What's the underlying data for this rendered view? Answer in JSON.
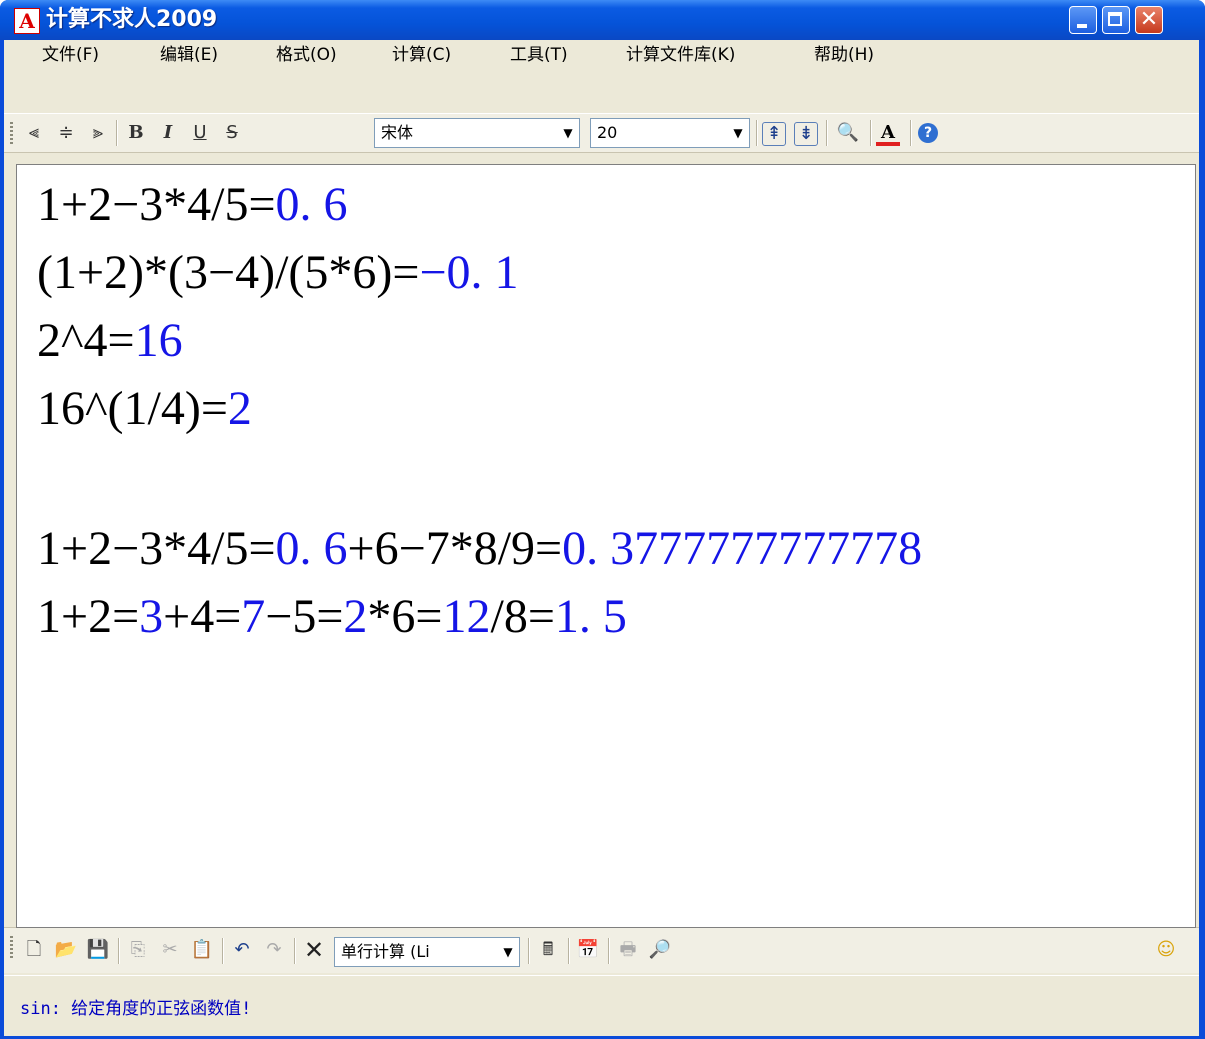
{
  "window": {
    "title": "计算不求人2009",
    "icon": "app-logo-icon"
  },
  "menu": {
    "file": "文件(F)",
    "edit": "编辑(E)",
    "format": "格式(O)",
    "compute": "计算(C)",
    "tools": "工具(T)",
    "library": "计算文件库(K)",
    "help": "帮助(H)"
  },
  "format_toolbar": {
    "font_name": "宋体",
    "font_size": "20",
    "bold": "B",
    "italic": "I",
    "underline": "U",
    "strike": "S",
    "font_color_glyph": "A"
  },
  "editor": {
    "lines": [
      {
        "expr": "1+2−3*4/5=",
        "result": "0. 6"
      },
      {
        "expr": "(1+2)*(3−4)/(5*6)=",
        "result": "−0. 1"
      },
      {
        "expr": "2^4=",
        "result": "16"
      },
      {
        "expr": "16^(1/4)=",
        "result": "2"
      }
    ],
    "chain1": {
      "p1": "1+2−3*4/5=",
      "r1": "0. 6",
      "p2": "+6−7*8/9=",
      "r2": "0. 3777777777778"
    },
    "chain2": {
      "p1": "1+2=",
      "r1": "3",
      "p2": "+4=",
      "r2": "7",
      "p3": "−5=",
      "r3": "2",
      "p4": "*6=",
      "r4": "12",
      "p5": "/8=",
      "r5": "1. 5"
    }
  },
  "bottom_toolbar": {
    "mode_label": "单行计算 (Li"
  },
  "status": {
    "text": "sin: 给定角度的正弦函数值!"
  },
  "colors": {
    "result": "#1515e6",
    "title_bar": "#0553d8"
  }
}
